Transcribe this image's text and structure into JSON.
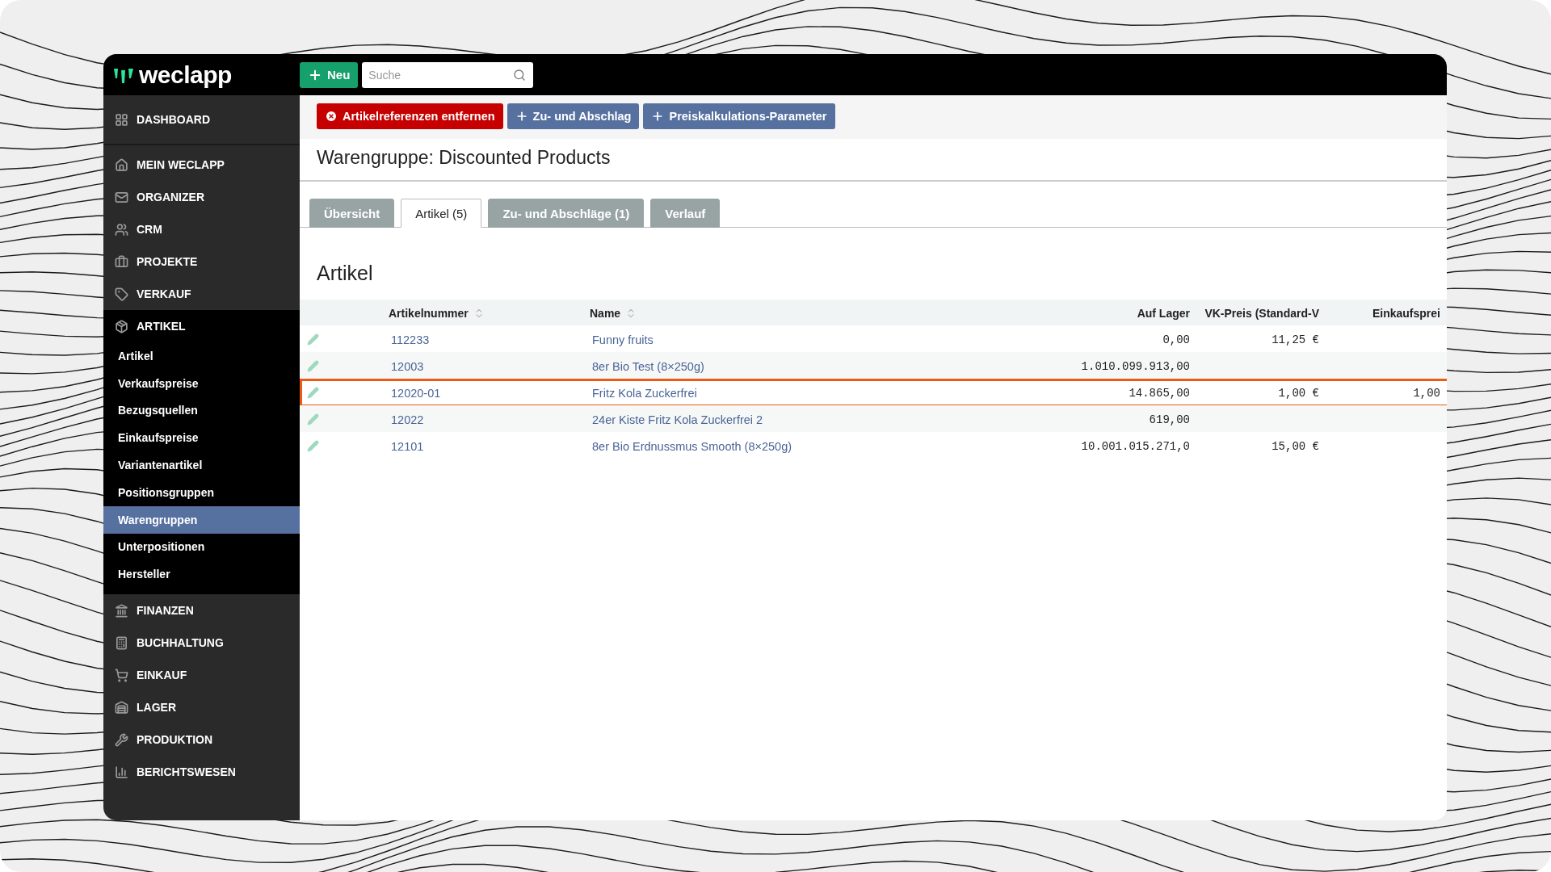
{
  "logo": {
    "text": "weclapp"
  },
  "topbar": {
    "new_button": "Neu",
    "search": {
      "placeholder": "Suche"
    }
  },
  "sidebar": {
    "items": [
      {
        "label": "DASHBOARD",
        "expanded": false
      },
      {
        "label": "MEIN WECLAPP",
        "expanded": false
      },
      {
        "label": "ORGANIZER",
        "expanded": false
      },
      {
        "label": "CRM",
        "expanded": false
      },
      {
        "label": "PROJEKTE",
        "expanded": false
      },
      {
        "label": "VERKAUF",
        "expanded": false
      },
      {
        "label": "ARTIKEL",
        "expanded": true,
        "children": [
          {
            "label": "Artikel",
            "selected": false
          },
          {
            "label": "Verkaufspreise",
            "selected": false
          },
          {
            "label": "Bezugsquellen",
            "selected": false
          },
          {
            "label": "Einkaufspreise",
            "selected": false
          },
          {
            "label": "Variantenartikel",
            "selected": false
          },
          {
            "label": "Positionsgruppen",
            "selected": false
          },
          {
            "label": "Warengruppen",
            "selected": true
          },
          {
            "label": "Unterpositionen",
            "selected": false
          },
          {
            "label": "Hersteller",
            "selected": false
          }
        ]
      },
      {
        "label": "FINANZEN",
        "expanded": false
      },
      {
        "label": "BUCHHALTUNG",
        "expanded": false
      },
      {
        "label": "EINKAUF",
        "expanded": false
      },
      {
        "label": "LAGER",
        "expanded": false
      },
      {
        "label": "PRODUKTION",
        "expanded": false
      },
      {
        "label": "BERICHTSWESEN",
        "expanded": false
      }
    ]
  },
  "actions": [
    {
      "label": "Artikelreferenzen entfernen",
      "kind": "danger"
    },
    {
      "label": "Zu- und Abschlag",
      "kind": "add"
    },
    {
      "label": "Preiskalkulations-Parameter",
      "kind": "add"
    }
  ],
  "title": "Warengruppe: Discounted Products",
  "tabs": [
    {
      "label": "Übersicht",
      "selected": false
    },
    {
      "label": "Artikel (5)",
      "selected": true
    },
    {
      "label": "Zu- und Abschläge (1)",
      "selected": false
    },
    {
      "label": "Verlauf",
      "selected": false
    }
  ],
  "section_title": "Artikel",
  "table": {
    "columns": [
      {
        "label": "Artikelnummer",
        "sortable": true
      },
      {
        "label": "Name",
        "sortable": true
      },
      {
        "label": "Auf Lager",
        "sortable": false
      },
      {
        "label": "VK-Preis (Standard-V",
        "sortable": false
      },
      {
        "label": "Einkaufsprei",
        "sortable": false
      }
    ],
    "rows": [
      {
        "highlighted": false,
        "cells": [
          "112233",
          "Funny fruits",
          "0,00",
          "11,25 €",
          null
        ]
      },
      {
        "highlighted": false,
        "cells": [
          "12003",
          "8er Bio Test (8×250g)",
          "1.010.099.913,00",
          null,
          null
        ]
      },
      {
        "highlighted": true,
        "cells": [
          "12020-01",
          "Fritz Kola Zuckerfrei",
          "14.865,00",
          "1,00 €",
          "1,00"
        ]
      },
      {
        "highlighted": false,
        "cells": [
          "12022",
          "24er Kiste Fritz Kola Zuckerfrei 2",
          "619,00",
          null,
          null
        ]
      },
      {
        "highlighted": false,
        "cells": [
          "12101",
          "8er Bio Erdnussmus Smooth (8×250g)",
          "10.001.015.271,0",
          "15,00 €",
          null
        ]
      }
    ]
  }
}
